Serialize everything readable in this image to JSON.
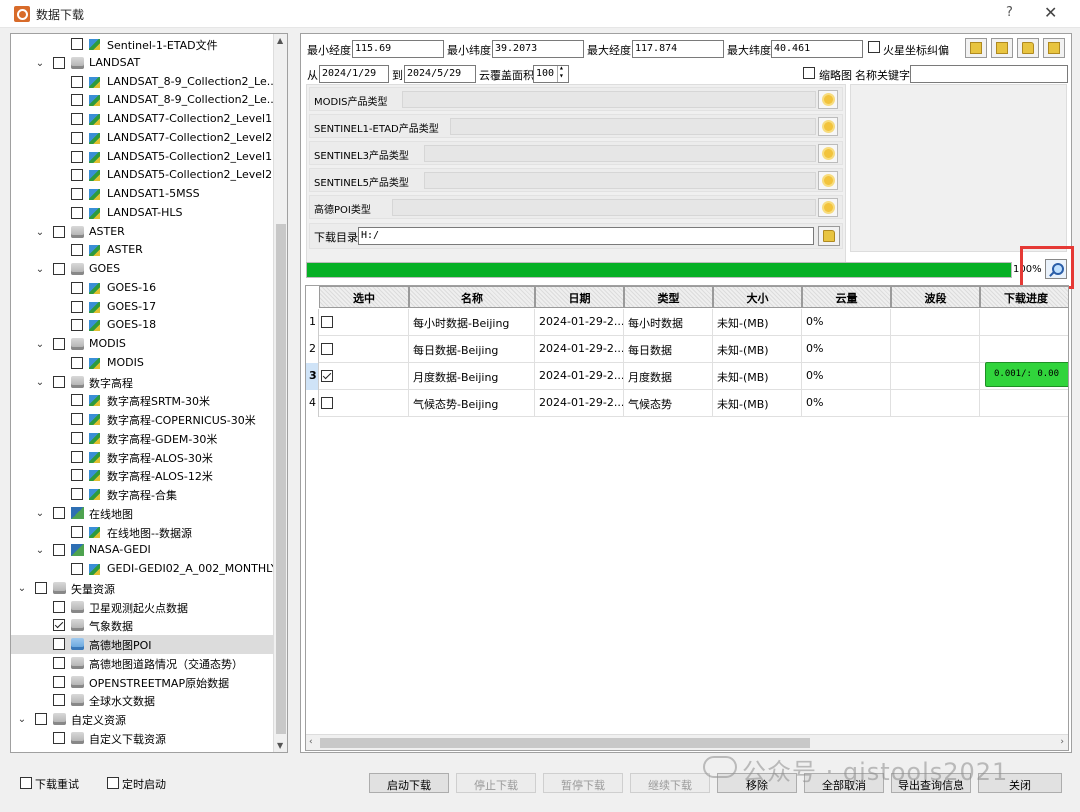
{
  "window": {
    "title": "数据下载",
    "help": "?",
    "close": "✕"
  },
  "tree": {
    "rows": [
      {
        "label": "Sentinel-1-ETAD文件",
        "checked": false
      },
      {
        "label": "LANDSAT",
        "checked": false
      },
      {
        "label": "LANDSAT_8-9_Collection2_Le...",
        "checked": false
      },
      {
        "label": "LANDSAT_8-9_Collection2_Le...",
        "checked": false
      },
      {
        "label": "LANDSAT7-Collection2_Level1",
        "checked": false
      },
      {
        "label": "LANDSAT7-Collection2_Level2",
        "checked": false
      },
      {
        "label": "LANDSAT5-Collection2_Level1",
        "checked": false
      },
      {
        "label": "LANDSAT5-Collection2_Level2",
        "checked": false
      },
      {
        "label": "LANDSAT1-5MSS",
        "checked": false
      },
      {
        "label": "LANDSAT-HLS",
        "checked": false
      },
      {
        "label": "ASTER",
        "checked": false
      },
      {
        "label": "ASTER",
        "checked": false
      },
      {
        "label": "GOES",
        "checked": false
      },
      {
        "label": "GOES-16",
        "checked": false
      },
      {
        "label": "GOES-17",
        "checked": false
      },
      {
        "label": "GOES-18",
        "checked": false
      },
      {
        "label": "MODIS",
        "checked": false
      },
      {
        "label": "MODIS",
        "checked": false
      },
      {
        "label": "数字高程",
        "checked": false
      },
      {
        "label": "数字高程SRTM-30米",
        "checked": false
      },
      {
        "label": "数字高程-COPERNICUS-30米",
        "checked": false
      },
      {
        "label": "数字高程-GDEM-30米",
        "checked": false
      },
      {
        "label": "数字高程-ALOS-30米",
        "checked": false
      },
      {
        "label": "数字高程-ALOS-12米",
        "checked": false
      },
      {
        "label": "数字高程-合集",
        "checked": false
      },
      {
        "label": "在线地图",
        "checked": false
      },
      {
        "label": "在线地图--数据源",
        "checked": false
      },
      {
        "label": "NASA-GEDI",
        "checked": false
      },
      {
        "label": "GEDI-GEDI02_A_002_MONTHLY",
        "checked": false
      },
      {
        "label": "矢量资源",
        "checked": false
      },
      {
        "label": "卫星观测起火点数据",
        "checked": false
      },
      {
        "label": "气象数据",
        "checked": true
      },
      {
        "label": "高德地图POI",
        "checked": false
      },
      {
        "label": "高德地图道路情况（交通态势）",
        "checked": false
      },
      {
        "label": "OPENSTREETMAP原始数据",
        "checked": false
      },
      {
        "label": "全球水文数据",
        "checked": false
      },
      {
        "label": "自定义资源",
        "checked": false
      },
      {
        "label": "自定义下载资源",
        "checked": false
      }
    ]
  },
  "coords": {
    "min_lon_label": "最小经度",
    "min_lon": "115.69",
    "min_lat_label": "最小纬度",
    "min_lat": "39.2073",
    "max_lon_label": "最大经度",
    "max_lon": "117.874",
    "max_lat_label": "最大纬度",
    "max_lat": "40.461",
    "mars_label": "火星坐标纠偏"
  },
  "filters": {
    "from_label": "从",
    "from_date": "2024/1/29",
    "to_label": "到",
    "to_date": "2024/5/29",
    "cloud_label": "云覆盖面积",
    "cloud_value": "100",
    "thumb_label": "缩略图",
    "keyword_label": "名称关键字",
    "keyword_value": ""
  },
  "products": [
    {
      "label": "MODIS产品类型"
    },
    {
      "label": "SENTINEL1-ETAD产品类型"
    },
    {
      "label": "SENTINEL3产品类型"
    },
    {
      "label": "SENTINEL5产品类型"
    },
    {
      "label": "高德POI类型"
    }
  ],
  "download_dir": {
    "label": "下载目录",
    "value": "H:/"
  },
  "progress": {
    "value": 1.0,
    "text": "100%",
    "accent": "#06b025"
  },
  "table": {
    "headers": [
      "选中",
      "名称",
      "日期",
      "类型",
      "大小",
      "云量",
      "波段",
      "下载进度"
    ],
    "rows": [
      {
        "num": "1",
        "checked": false,
        "name": "每小时数据-Beijing",
        "date": "2024-01-29-2...",
        "type": "每小时数据",
        "size": "未知-(MB)",
        "cloud": "0%",
        "band": "",
        "progress": ""
      },
      {
        "num": "2",
        "checked": false,
        "name": "每日数据-Beijing",
        "date": "2024-01-29-2...",
        "type": "每日数据",
        "size": "未知-(MB)",
        "cloud": "0%",
        "band": "",
        "progress": ""
      },
      {
        "num": "3",
        "checked": true,
        "name": "月度数据-Beijing",
        "date": "2024-01-29-2...",
        "type": "月度数据",
        "size": "未知-(MB)",
        "cloud": "0%",
        "band": "",
        "progress": "0.001/:      0.00"
      },
      {
        "num": "4",
        "checked": false,
        "name": "气候态势-Beijing",
        "date": "2024-01-29-2...",
        "type": "气候态势",
        "size": "未知-(MB)",
        "cloud": "0%",
        "band": "",
        "progress": ""
      }
    ]
  },
  "footer": {
    "retry_label": "下载重试",
    "timer_label": "定时启动",
    "buttons": [
      "启动下载",
      "停止下载",
      "暂停下载",
      "继续下载",
      "移除",
      "全部取消",
      "导出查询信息",
      "关闭"
    ],
    "watermark": "公众号 · gistools2021"
  }
}
